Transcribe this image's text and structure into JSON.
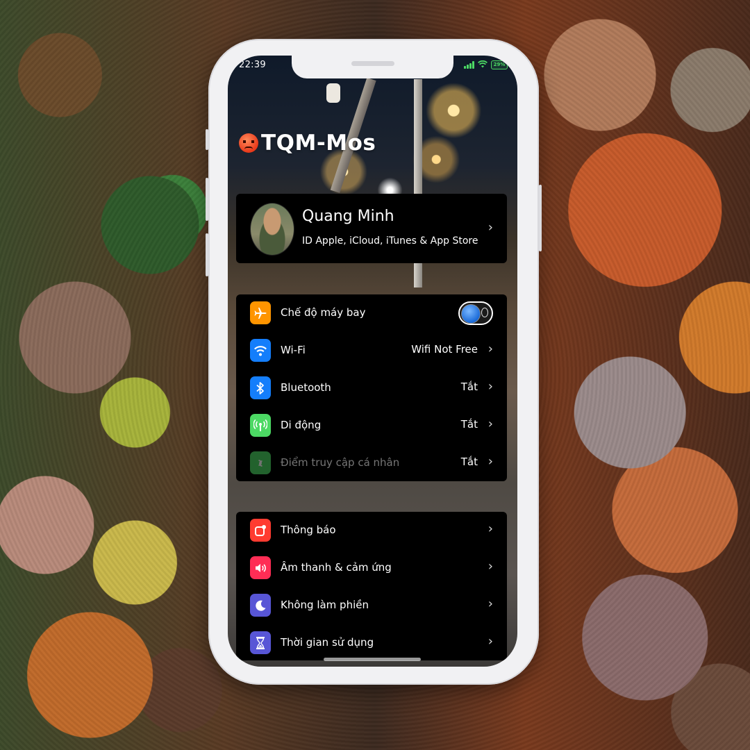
{
  "status": {
    "time": "22:39",
    "battery": "29%"
  },
  "brand": {
    "title": "TQM-Mos"
  },
  "profile": {
    "name": "Quang Minh",
    "subtitle": "ID Apple, iCloud, iTunes & App Store"
  },
  "group1": [
    {
      "label": "Chế độ máy bay",
      "value": "",
      "icon": "airplane-icon",
      "color": "#ff9500",
      "toggle": true
    },
    {
      "label": "Wi-Fi",
      "value": "Wifi Not Free",
      "icon": "wifi-icon",
      "color": "#147efb"
    },
    {
      "label": "Bluetooth",
      "value": "Tắt",
      "icon": "bluetooth-icon",
      "color": "#147efb"
    },
    {
      "label": "Di động",
      "value": "Tắt",
      "icon": "cellular-icon",
      "color": "#4cd964"
    },
    {
      "label": "Điểm truy cập cá nhân",
      "value": "Tắt",
      "icon": "hotspot-icon",
      "color": "#4cd964",
      "dimmed": true
    }
  ],
  "group2": [
    {
      "label": "Thông báo",
      "icon": "notifications-icon",
      "color": "#ff3b30"
    },
    {
      "label": "Âm thanh & cảm ứng",
      "icon": "sound-icon",
      "color": "#ff2d55"
    },
    {
      "label": "Không làm phiền",
      "icon": "moon-icon",
      "color": "#5856d6"
    },
    {
      "label": "Thời gian sử dụng",
      "icon": "hourglass-icon",
      "color": "#5856d6"
    }
  ]
}
